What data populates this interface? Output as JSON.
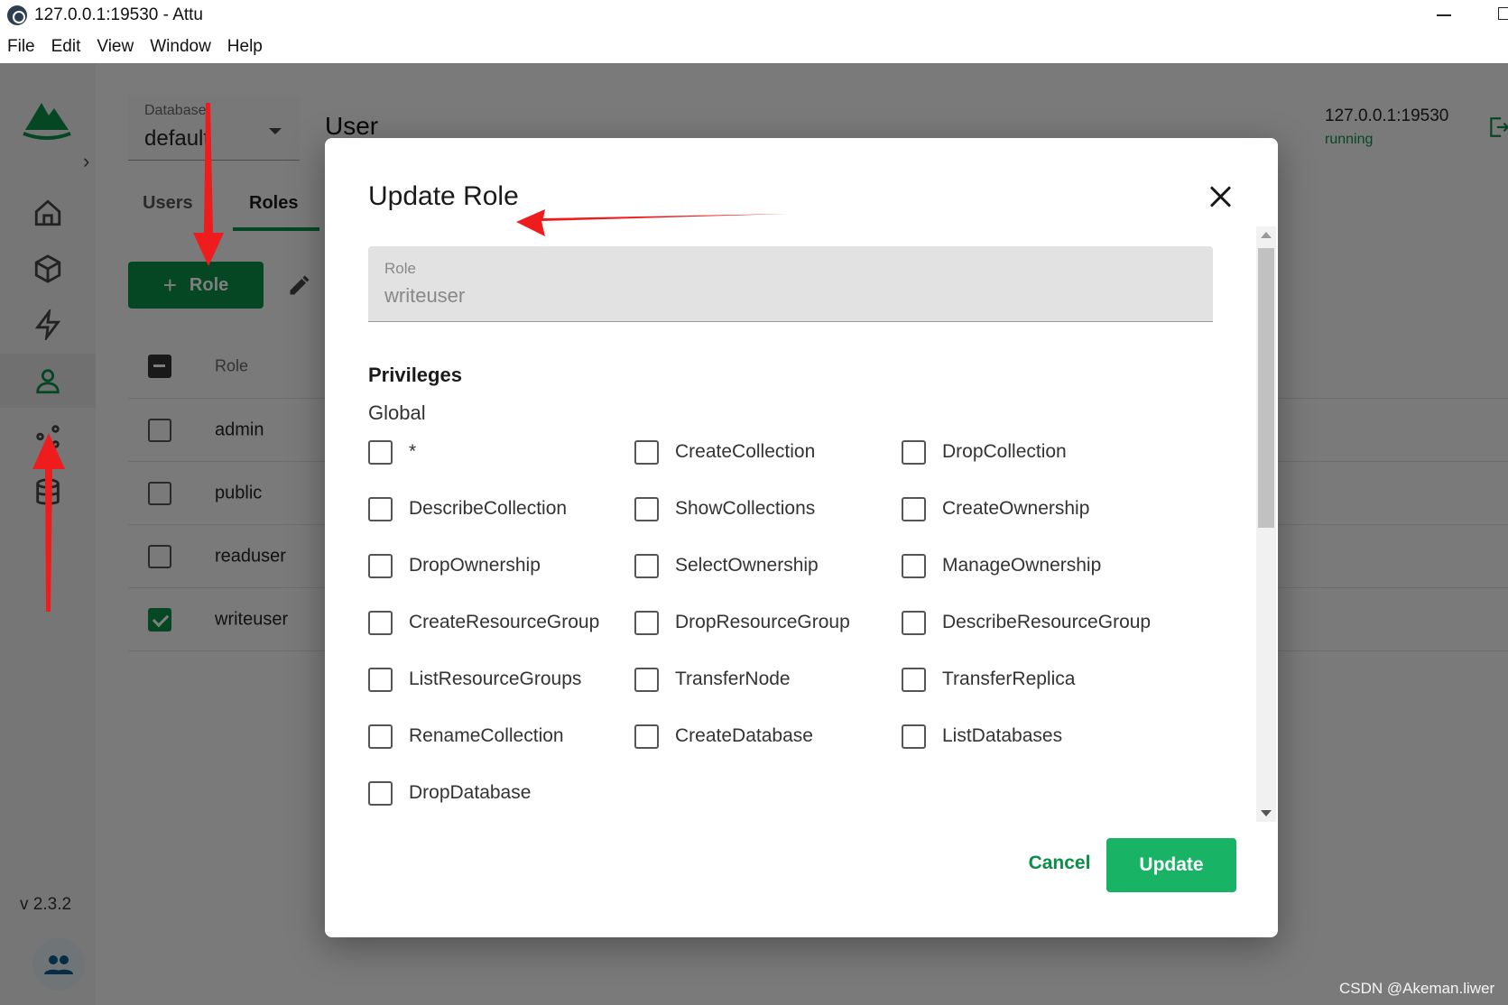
{
  "window": {
    "title": "127.0.0.1:19530 - Attu"
  },
  "menu": [
    "File",
    "Edit",
    "View",
    "Window",
    "Help"
  ],
  "sidebar": {
    "version": "v 2.3.2",
    "items": [
      "home-icon",
      "collection-icon",
      "bolt-icon",
      "user-icon",
      "system-icon",
      "database-icon"
    ],
    "active": "user-icon"
  },
  "header": {
    "database_label": "Database",
    "database_value": "default",
    "page_title": "User",
    "server_address": "127.0.0.1:19530",
    "server_status": "running"
  },
  "tabs": [
    "Users",
    "Roles"
  ],
  "active_tab": "Roles",
  "toolbar": {
    "add_role_label": "Role"
  },
  "roles_table": {
    "header": "Role",
    "rows": [
      {
        "name": "admin",
        "checked": false
      },
      {
        "name": "public",
        "checked": false
      },
      {
        "name": "readuser",
        "checked": false
      },
      {
        "name": "writeuser",
        "checked": true
      }
    ]
  },
  "dialog": {
    "title": "Update Role",
    "role_label": "Role",
    "role_value": "writeuser",
    "privileges_title": "Privileges",
    "group_label": "Global",
    "privileges": [
      "*",
      "CreateCollection",
      "DropCollection",
      "DescribeCollection",
      "ShowCollections",
      "CreateOwnership",
      "DropOwnership",
      "SelectOwnership",
      "ManageOwnership",
      "CreateResourceGroup",
      "DropResourceGroup",
      "DescribeResourceGroup",
      "ListResourceGroups",
      "TransferNode",
      "TransferReplica",
      "RenameCollection",
      "CreateDatabase",
      "ListDatabases",
      "DropDatabase"
    ],
    "cancel_label": "Cancel",
    "update_label": "Update"
  },
  "annotation_color": "#ee1c1c",
  "brand_color": "#0a8f47",
  "watermark": "CSDN @Akeman.liwer"
}
